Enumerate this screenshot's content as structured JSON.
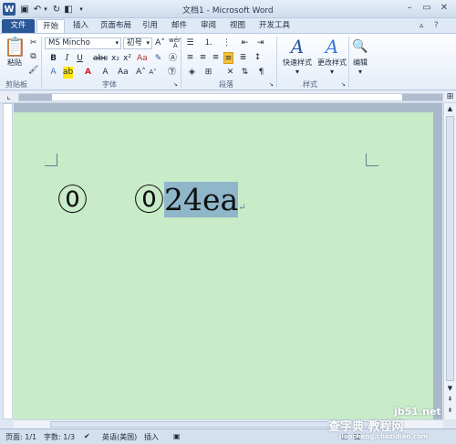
{
  "window": {
    "title": "文档1 - Microsoft Word"
  },
  "tabs": [
    "文件",
    "开始",
    "插入",
    "页面布局",
    "引用",
    "邮件",
    "审阅",
    "视图",
    "开发工具"
  ],
  "ribbon": {
    "clipboard": {
      "paste_label": "粘贴",
      "group_label": "剪贴板"
    },
    "font": {
      "font_name": "MS Mincho",
      "font_size": "初号",
      "group_label": "字体",
      "phonetic_label": "wén"
    },
    "paragraph": {
      "group_label": "段落"
    },
    "styles": {
      "quick_styles_label": "快速样式",
      "change_styles_label": "更改样式",
      "group_label": "样式"
    },
    "editing": {
      "label": "编辑"
    }
  },
  "document": {
    "text_1": "⓪",
    "text_2a": "⓪",
    "text_2b": "24ea"
  },
  "status": {
    "page": "页面: 1/1",
    "words": "字数: 1/3",
    "language": "英语(美国)",
    "mode": "插入"
  },
  "watermark": {
    "site": "jb51.net",
    "brand": "查字典 教程网",
    "url": "jiaocheng.chazidian.com"
  }
}
